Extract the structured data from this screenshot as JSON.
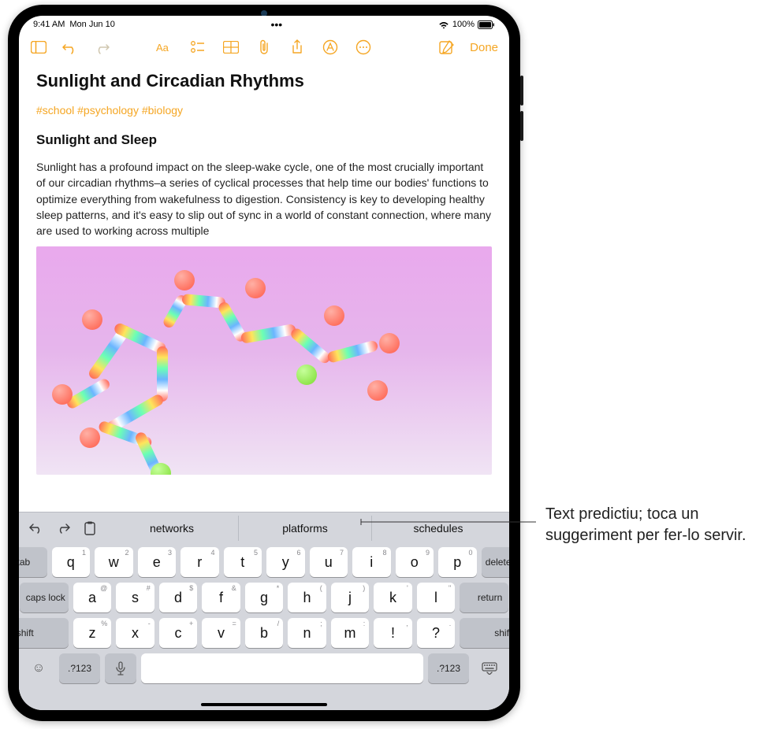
{
  "status": {
    "time": "9:41 AM",
    "date": "Mon Jun 10",
    "battery_pct": "100%"
  },
  "toolbar": {
    "done": "Done"
  },
  "note": {
    "title": "Sunlight and Circadian Rhythms",
    "tags": "#school #psychology #biology",
    "heading2": "Sunlight and Sleep",
    "paragraph": "Sunlight has a profound impact on the sleep-wake cycle, one of the most crucially important of our circadian rhythms–a series of cyclical processes that help time our bodies' functions to optimize everything from wakefulness to digestion. Consistency is key to developing healthy sleep patterns, and it's easy to slip out of sync in a world of constant connection, where many are used to working across multiple"
  },
  "predictive": {
    "suggestions": [
      "networks",
      "platforms",
      "schedules"
    ]
  },
  "keyboard": {
    "row1": [
      {
        "c": "q",
        "a": "1"
      },
      {
        "c": "w",
        "a": "2"
      },
      {
        "c": "e",
        "a": "3"
      },
      {
        "c": "r",
        "a": "4"
      },
      {
        "c": "t",
        "a": "5"
      },
      {
        "c": "y",
        "a": "6"
      },
      {
        "c": "u",
        "a": "7"
      },
      {
        "c": "i",
        "a": "8"
      },
      {
        "c": "o",
        "a": "9"
      },
      {
        "c": "p",
        "a": "0"
      }
    ],
    "row1_left": "tab",
    "row1_right": "delete",
    "row2": [
      {
        "c": "a",
        "a": "@"
      },
      {
        "c": "s",
        "a": "#"
      },
      {
        "c": "d",
        "a": "$"
      },
      {
        "c": "f",
        "a": "&"
      },
      {
        "c": "g",
        "a": "*"
      },
      {
        "c": "h",
        "a": "("
      },
      {
        "c": "j",
        "a": ")"
      },
      {
        "c": "k",
        "a": "'"
      },
      {
        "c": "l",
        "a": "\""
      }
    ],
    "row2_left": "caps lock",
    "row2_right": "return",
    "row3": [
      {
        "c": "z",
        "a": "%"
      },
      {
        "c": "x",
        "a": "-"
      },
      {
        "c": "c",
        "a": "+"
      },
      {
        "c": "v",
        "a": "="
      },
      {
        "c": "b",
        "a": "/"
      },
      {
        "c": "n",
        "a": ";"
      },
      {
        "c": "m",
        "a": ":"
      },
      {
        "c": "!",
        "a": ","
      },
      {
        "c": "?",
        "a": "."
      }
    ],
    "row3_mod": "shift",
    "row4_num": ".?123"
  },
  "callout": {
    "text": "Text predictiu; toca un suggeriment per fer-lo servir."
  }
}
